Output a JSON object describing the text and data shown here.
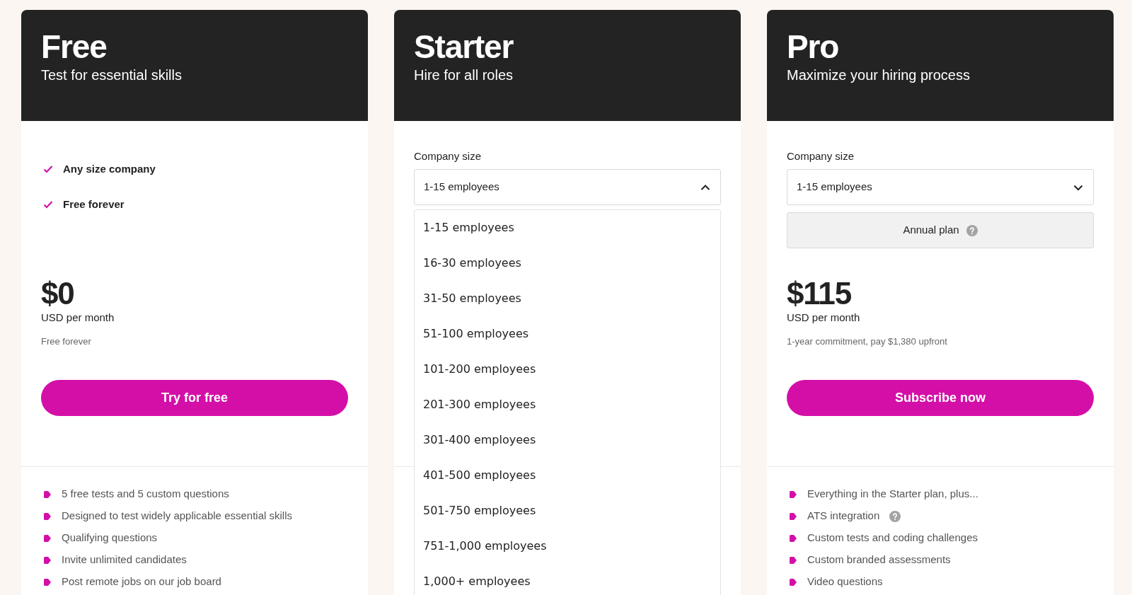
{
  "plans": [
    {
      "kind": "highlights",
      "name": "Free",
      "tagline": "Test for essential skills",
      "highlights": [
        "Any size company",
        "Free forever"
      ],
      "price": "$0",
      "period": "USD per month",
      "note": "Free forever",
      "cta": "Try for free",
      "features": [
        {
          "text": "5 free tests and 5 custom questions",
          "help": false
        },
        {
          "text": "Designed to test widely applicable essential skills",
          "help": false
        },
        {
          "text": "Qualifying questions",
          "help": false
        },
        {
          "text": "Invite unlimited candidates",
          "help": false
        },
        {
          "text": "Post remote jobs on our job board",
          "help": false
        }
      ]
    },
    {
      "kind": "sized",
      "name": "Starter",
      "tagline": "Hire for all roles",
      "company_size": {
        "label": "Company size",
        "value": "1-15 employees",
        "expanded": true,
        "options": [
          "1-15 employees",
          "16-30 employees",
          "31-50 employees",
          "51-100 employees",
          "101-200 employees",
          "201-300 employees",
          "301-400 employees",
          "401-500 employees",
          "501-750 employees",
          "751-1,000 employees",
          "1,000+ employees"
        ]
      }
    },
    {
      "kind": "sized",
      "name": "Pro",
      "tagline": "Maximize your hiring process",
      "company_size": {
        "label": "Company size",
        "value": "1-15 employees",
        "expanded": false
      },
      "billing": "Annual plan",
      "price": "$115",
      "period": "USD per month",
      "note": "1-year commitment, pay $1,380 upfront",
      "cta": "Subscribe now",
      "features": [
        {
          "text": "Everything in the Starter plan, plus...",
          "help": false
        },
        {
          "text": "ATS integration",
          "help": true
        },
        {
          "text": "Custom tests and coding challenges",
          "help": false
        },
        {
          "text": "Custom branded assessments",
          "help": false
        },
        {
          "text": "Video questions",
          "help": false
        }
      ]
    }
  ]
}
